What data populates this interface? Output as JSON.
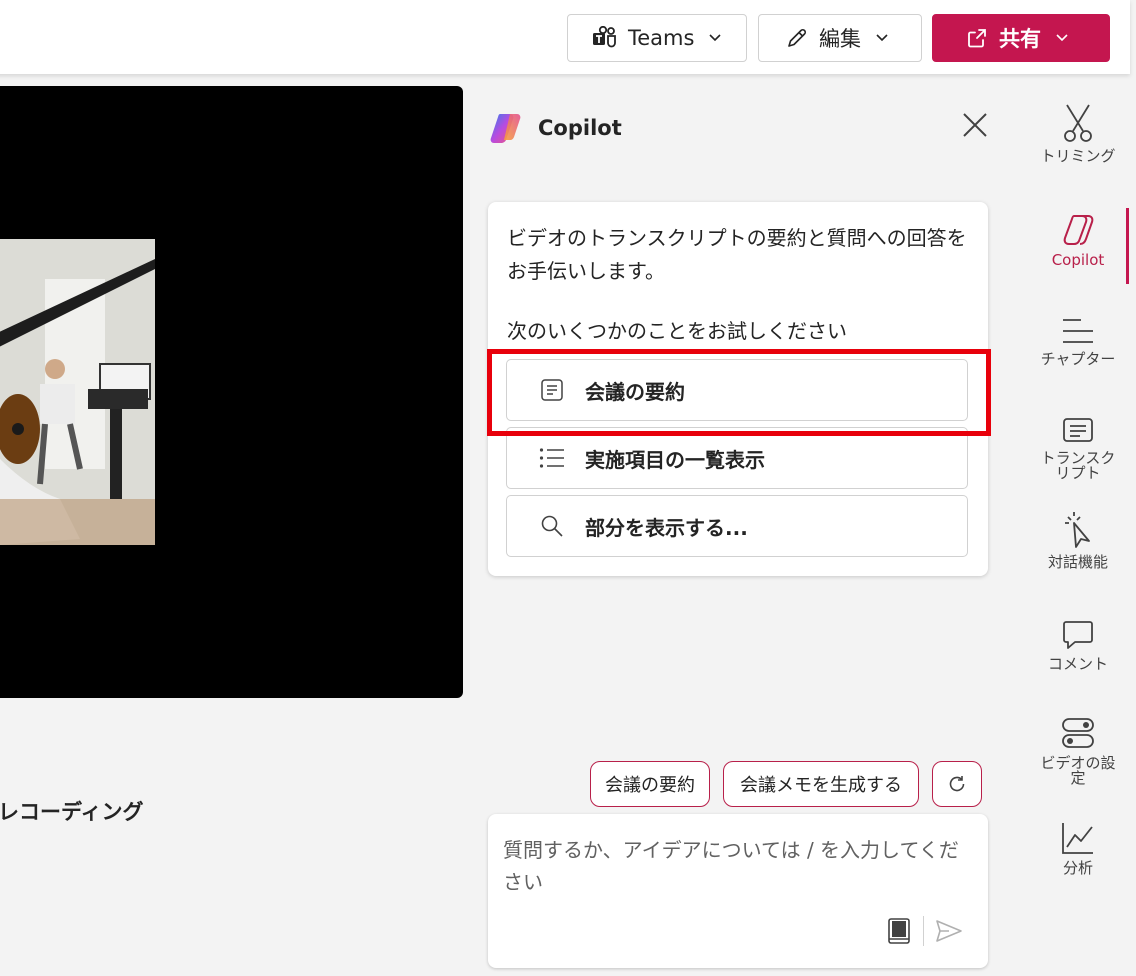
{
  "topbar": {
    "teams_label": "Teams",
    "edit_label": "編集",
    "share_label": "共有"
  },
  "video": {
    "recording_title_fragment": "レコーディング"
  },
  "copilot": {
    "title": "Copilot",
    "intro": "ビデオのトランスクリプトの要約と質問への回答をお手伝いします。",
    "try_label": "次のいくつかのことをお試しください",
    "suggestions": [
      {
        "label": "会議の要約",
        "icon": "document-lines-icon"
      },
      {
        "label": "実施項目の一覧表示",
        "icon": "bulleted-list-icon"
      },
      {
        "label": "部分を表示する...",
        "icon": "search-icon"
      }
    ],
    "chips": [
      "会議の要約",
      "会議メモを生成する"
    ],
    "input_placeholder": "質問するか、アイデアについては / を入力してください"
  },
  "rail": {
    "items": [
      {
        "label": "トリミング",
        "icon": "scissors-icon"
      },
      {
        "label": "Copilot",
        "icon": "copilot-icon",
        "active": true
      },
      {
        "label": "チャプター",
        "icon": "chapters-icon"
      },
      {
        "label": "トランスクリプト",
        "icon": "transcript-icon"
      },
      {
        "label": "対話機能",
        "icon": "interactivity-icon"
      },
      {
        "label": "コメント",
        "icon": "comment-icon"
      },
      {
        "label": "ビデオの設定",
        "icon": "video-settings-icon"
      },
      {
        "label": "分析",
        "icon": "analytics-icon"
      }
    ]
  },
  "colors": {
    "accent": "#c4164f",
    "highlight_box": "#e8000b",
    "chip_border": "#b8204a"
  }
}
